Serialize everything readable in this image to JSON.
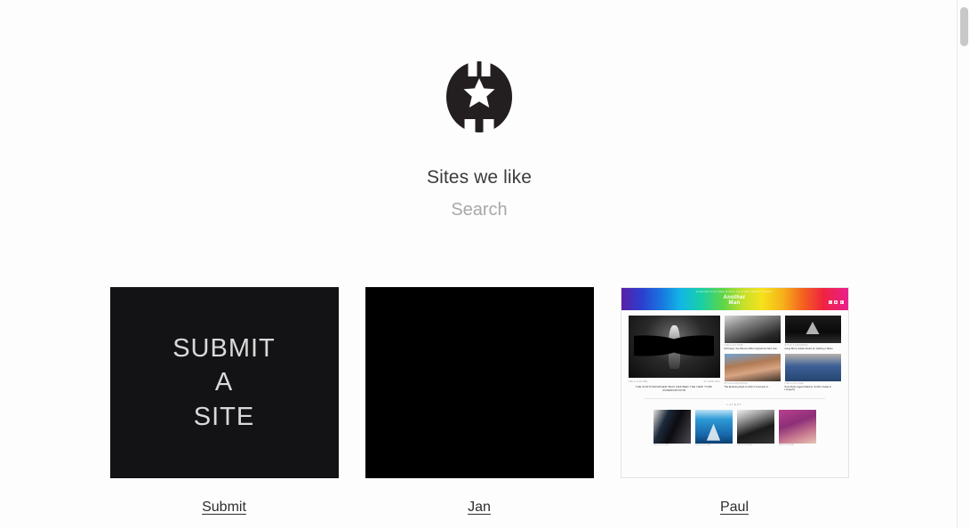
{
  "page": {
    "background_color": "#fdfdfd",
    "title": "Sites we like"
  },
  "header": {
    "logo_name": "notched-circle-star-logo",
    "logo_color": "#231f20",
    "logo_star_color": "#ffffff",
    "title": "Sites we like"
  },
  "search": {
    "placeholder": "Search",
    "value": ""
  },
  "cards": [
    {
      "id": "submit",
      "label": "Submit",
      "thumb_type": "submit-tile",
      "thumb_background": "#131316",
      "tile_lines": [
        "SUBMIT",
        "A",
        "SITE"
      ],
      "tile_text_color": "#d9d9d9"
    },
    {
      "id": "jan",
      "label": "Jan",
      "thumb_type": "black-tile",
      "thumb_background": "#000000"
    },
    {
      "id": "paul",
      "label": "Paul",
      "thumb_type": "site-screenshot",
      "screenshot": {
        "brand_line_1": "Another",
        "brand_line_2": "Man",
        "nav": "FASHION  CULTURE  MUSIC  FILM  ART  BEAUTY  SHOP",
        "social": [
          "f",
          "■",
          "▾"
        ],
        "hero": {
          "tag_left": "LIFE & CULTURE",
          "tag_right": "23 JUNE 2020",
          "caption": "THE PHOTOGRAPHER WHO DEFINED THE NEW YORK UNDERGROUND"
        },
        "articles": [
          {
            "tag": "LIFE & CULTURE",
            "caption": "Morrissey: the Women Who Inspired the Moz Icon"
          },
          {
            "tag": "STYLE & GROOMING",
            "caption": "Gang Bini's Golden Rules for Getting a Tattoo"
          },
          {
            "tag": "STYLE & GROOMING",
            "caption": "The Enduring Style of John F. Kennedy Jr."
          },
          {
            "tag": "LIFE & CULTURE",
            "caption": "Post-Punk Legend Mark E. Smith's Guide to Longevity"
          }
        ],
        "latest_label": "LATEST",
        "latest": [
          {
            "tag": "LIFE & CULTURE"
          },
          {
            "tag": "FILM & CULTURE"
          },
          {
            "tag": "LIFE & CULTURE"
          },
          {
            "tag": "LIFE & CULTURE"
          }
        ]
      }
    }
  ],
  "scrollbar": {
    "name": "vertical-scrollbar",
    "thumb_color": "#c8c8c8"
  }
}
